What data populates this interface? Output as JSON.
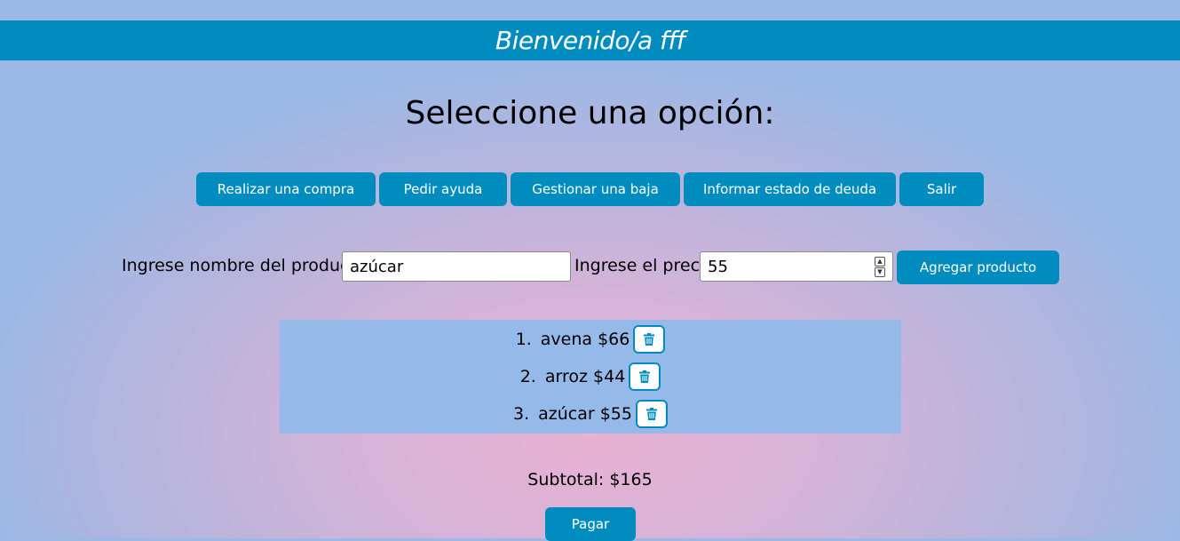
{
  "header": {
    "title": "Bienvenido/a fff"
  },
  "page_title": "Seleccione una opción:",
  "menu": [
    {
      "label": "Realizar una compra"
    },
    {
      "label": "Pedir ayuda"
    },
    {
      "label": "Gestionar una baja"
    },
    {
      "label": "Informar estado de deuda"
    },
    {
      "label": "Salir"
    }
  ],
  "form": {
    "product_label": "Ingrese nombre del producto",
    "product_value": "azúcar",
    "price_label": "Ingrese el precio",
    "price_value": "55",
    "add_button": "Agregar producto"
  },
  "products": [
    {
      "num": "1.",
      "text": "avena $66"
    },
    {
      "num": "2.",
      "text": "arroz $44"
    },
    {
      "num": "3.",
      "text": "azúcar $55"
    }
  ],
  "subtotal": "Subtotal: $165",
  "pay_button": "Pagar",
  "colors": {
    "accent": "#008cbf",
    "list_bg": "#95baea"
  },
  "icons": {
    "delete": "trash-icon",
    "spinner_up": "spinner-up-icon",
    "spinner_down": "spinner-down-icon"
  }
}
